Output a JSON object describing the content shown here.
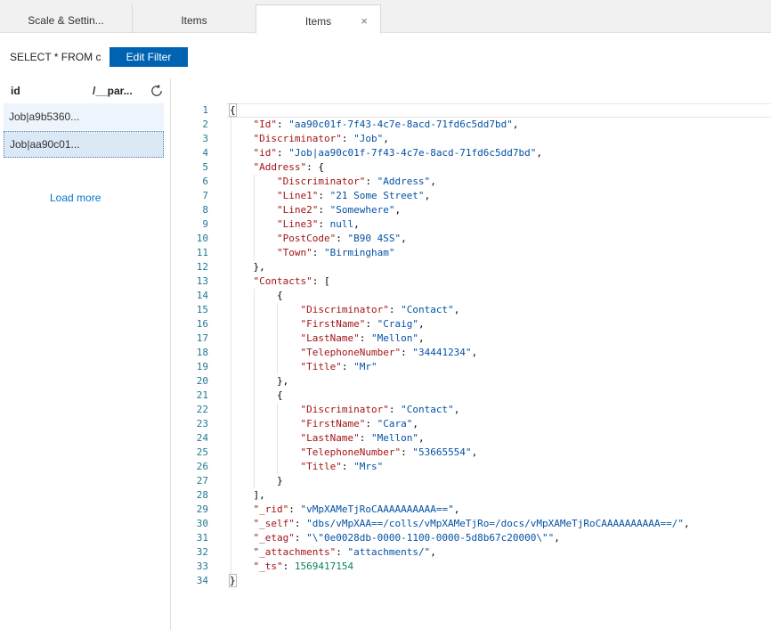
{
  "tabs": [
    {
      "label": "Scale & Settin..."
    },
    {
      "label": "Items"
    },
    {
      "label": "Items",
      "close": "×",
      "active": true
    }
  ],
  "query": {
    "text": "SELECT * FROM c",
    "edit_filter_label": "Edit Filter"
  },
  "documents": {
    "columns": {
      "id": "id",
      "partition": "/__par..."
    },
    "refresh_icon": "refresh-icon",
    "rows": [
      {
        "id": "Job|a9b5360..."
      },
      {
        "id": "Job|aa90c01..."
      }
    ],
    "load_more_label": "Load more"
  },
  "editor": {
    "line_numbers": [
      "1",
      "2",
      "3",
      "4",
      "5",
      "6",
      "7",
      "8",
      "9",
      "10",
      "11",
      "12",
      "13",
      "14",
      "15",
      "16",
      "17",
      "18",
      "19",
      "20",
      "21",
      "22",
      "23",
      "24",
      "25",
      "26",
      "27",
      "28",
      "29",
      "30",
      "31",
      "32",
      "33",
      "34"
    ],
    "lines": [
      [
        [
          "p",
          "{"
        ]
      ],
      [
        [
          "p",
          "    "
        ],
        [
          "k",
          "\"Id\""
        ],
        [
          "p",
          ": "
        ],
        [
          "s",
          "\"aa90c01f-7f43-4c7e-8acd-71fd6c5dd7bd\""
        ],
        [
          "p",
          ","
        ]
      ],
      [
        [
          "p",
          "    "
        ],
        [
          "k",
          "\"Discriminator\""
        ],
        [
          "p",
          ": "
        ],
        [
          "s",
          "\"Job\""
        ],
        [
          "p",
          ","
        ]
      ],
      [
        [
          "p",
          "    "
        ],
        [
          "k",
          "\"id\""
        ],
        [
          "p",
          ": "
        ],
        [
          "s",
          "\"Job|aa90c01f-7f43-4c7e-8acd-71fd6c5dd7bd\""
        ],
        [
          "p",
          ","
        ]
      ],
      [
        [
          "p",
          "    "
        ],
        [
          "k",
          "\"Address\""
        ],
        [
          "p",
          ": {"
        ]
      ],
      [
        [
          "p",
          "        "
        ],
        [
          "k",
          "\"Discriminator\""
        ],
        [
          "p",
          ": "
        ],
        [
          "s",
          "\"Address\""
        ],
        [
          "p",
          ","
        ]
      ],
      [
        [
          "p",
          "        "
        ],
        [
          "k",
          "\"Line1\""
        ],
        [
          "p",
          ": "
        ],
        [
          "s",
          "\"21 Some Street\""
        ],
        [
          "p",
          ","
        ]
      ],
      [
        [
          "p",
          "        "
        ],
        [
          "k",
          "\"Line2\""
        ],
        [
          "p",
          ": "
        ],
        [
          "s",
          "\"Somewhere\""
        ],
        [
          "p",
          ","
        ]
      ],
      [
        [
          "p",
          "        "
        ],
        [
          "k",
          "\"Line3\""
        ],
        [
          "p",
          ": "
        ],
        [
          "s",
          "null"
        ],
        [
          "p",
          ","
        ]
      ],
      [
        [
          "p",
          "        "
        ],
        [
          "k",
          "\"PostCode\""
        ],
        [
          "p",
          ": "
        ],
        [
          "s",
          "\"B90 4SS\""
        ],
        [
          "p",
          ","
        ]
      ],
      [
        [
          "p",
          "        "
        ],
        [
          "k",
          "\"Town\""
        ],
        [
          "p",
          ": "
        ],
        [
          "s",
          "\"Birmingham\""
        ]
      ],
      [
        [
          "p",
          "    },"
        ]
      ],
      [
        [
          "p",
          "    "
        ],
        [
          "k",
          "\"Contacts\""
        ],
        [
          "p",
          ": ["
        ]
      ],
      [
        [
          "p",
          "        {"
        ]
      ],
      [
        [
          "p",
          "            "
        ],
        [
          "k",
          "\"Discriminator\""
        ],
        [
          "p",
          ": "
        ],
        [
          "s",
          "\"Contact\""
        ],
        [
          "p",
          ","
        ]
      ],
      [
        [
          "p",
          "            "
        ],
        [
          "k",
          "\"FirstName\""
        ],
        [
          "p",
          ": "
        ],
        [
          "s",
          "\"Craig\""
        ],
        [
          "p",
          ","
        ]
      ],
      [
        [
          "p",
          "            "
        ],
        [
          "k",
          "\"LastName\""
        ],
        [
          "p",
          ": "
        ],
        [
          "s",
          "\"Mellon\""
        ],
        [
          "p",
          ","
        ]
      ],
      [
        [
          "p",
          "            "
        ],
        [
          "k",
          "\"TelephoneNumber\""
        ],
        [
          "p",
          ": "
        ],
        [
          "s",
          "\"34441234\""
        ],
        [
          "p",
          ","
        ]
      ],
      [
        [
          "p",
          "            "
        ],
        [
          "k",
          "\"Title\""
        ],
        [
          "p",
          ": "
        ],
        [
          "s",
          "\"Mr\""
        ]
      ],
      [
        [
          "p",
          "        },"
        ]
      ],
      [
        [
          "p",
          "        {"
        ]
      ],
      [
        [
          "p",
          "            "
        ],
        [
          "k",
          "\"Discriminator\""
        ],
        [
          "p",
          ": "
        ],
        [
          "s",
          "\"Contact\""
        ],
        [
          "p",
          ","
        ]
      ],
      [
        [
          "p",
          "            "
        ],
        [
          "k",
          "\"FirstName\""
        ],
        [
          "p",
          ": "
        ],
        [
          "s",
          "\"Cara\""
        ],
        [
          "p",
          ","
        ]
      ],
      [
        [
          "p",
          "            "
        ],
        [
          "k",
          "\"LastName\""
        ],
        [
          "p",
          ": "
        ],
        [
          "s",
          "\"Mellon\""
        ],
        [
          "p",
          ","
        ]
      ],
      [
        [
          "p",
          "            "
        ],
        [
          "k",
          "\"TelephoneNumber\""
        ],
        [
          "p",
          ": "
        ],
        [
          "s",
          "\"53665554\""
        ],
        [
          "p",
          ","
        ]
      ],
      [
        [
          "p",
          "            "
        ],
        [
          "k",
          "\"Title\""
        ],
        [
          "p",
          ": "
        ],
        [
          "s",
          "\"Mrs\""
        ]
      ],
      [
        [
          "p",
          "        }"
        ]
      ],
      [
        [
          "p",
          "    ],"
        ]
      ],
      [
        [
          "p",
          "    "
        ],
        [
          "k",
          "\"_rid\""
        ],
        [
          "p",
          ": "
        ],
        [
          "s",
          "\"vMpXAMeTjRoCAAAAAAAAAA==\""
        ],
        [
          "p",
          ","
        ]
      ],
      [
        [
          "p",
          "    "
        ],
        [
          "k",
          "\"_self\""
        ],
        [
          "p",
          ": "
        ],
        [
          "s",
          "\"dbs/vMpXAA==/colls/vMpXAMeTjRo=/docs/vMpXAMeTjRoCAAAAAAAAAA==/\""
        ],
        [
          "p",
          ","
        ]
      ],
      [
        [
          "p",
          "    "
        ],
        [
          "k",
          "\"_etag\""
        ],
        [
          "p",
          ": "
        ],
        [
          "s",
          "\"\\\"0e0028db-0000-1100-0000-5d8b67c20000\\\"\""
        ],
        [
          "p",
          ","
        ]
      ],
      [
        [
          "p",
          "    "
        ],
        [
          "k",
          "\"_attachments\""
        ],
        [
          "p",
          ": "
        ],
        [
          "s",
          "\"attachments/\""
        ],
        [
          "p",
          ","
        ]
      ],
      [
        [
          "p",
          "    "
        ],
        [
          "k",
          "\"_ts\""
        ],
        [
          "p",
          ": "
        ],
        [
          "n",
          "1569417154"
        ]
      ],
      [
        [
          "p",
          "}"
        ]
      ]
    ]
  }
}
